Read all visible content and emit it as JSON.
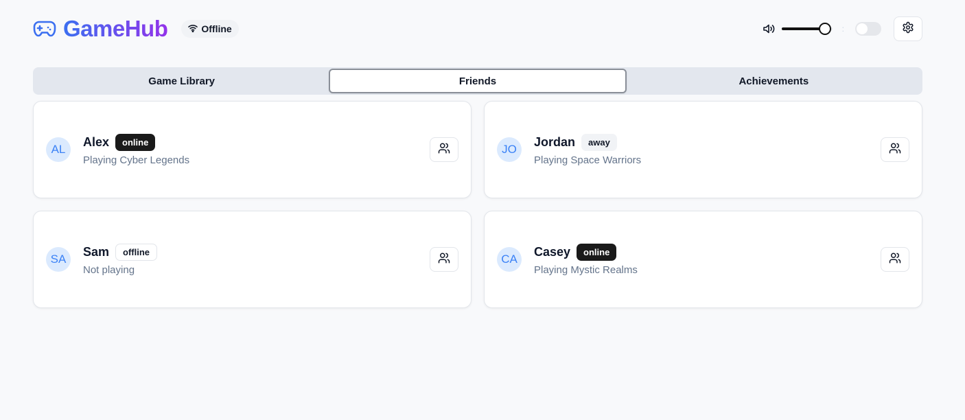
{
  "app": {
    "title": "GameHub",
    "connection_status": "Offline"
  },
  "icons": {
    "logo": "gamepad-icon",
    "connection": "wifi-icon",
    "volume": "volume-icon",
    "settings": "gear-icon",
    "friend_action": "users-icon"
  },
  "colors": {
    "brand_gradient_start": "#3b6ff0",
    "brand_gradient_end": "#9333ea",
    "online_badge": "#1a1a1a",
    "avatar_bg": "#dbeafe",
    "avatar_text": "#3b82f6"
  },
  "volume": {
    "level_percent": 85
  },
  "theme_toggle": {
    "on": false
  },
  "tabs": [
    {
      "label": "Game Library",
      "active": false
    },
    {
      "label": "Friends",
      "active": true
    },
    {
      "label": "Achievements",
      "active": false
    }
  ],
  "friends": [
    {
      "initials": "AL",
      "name": "Alex",
      "status": "online",
      "activity": "Playing Cyber Legends"
    },
    {
      "initials": "JO",
      "name": "Jordan",
      "status": "away",
      "activity": "Playing Space Warriors"
    },
    {
      "initials": "SA",
      "name": "Sam",
      "status": "offline",
      "activity": "Not playing"
    },
    {
      "initials": "CA",
      "name": "Casey",
      "status": "online",
      "activity": "Playing Mystic Realms"
    }
  ]
}
